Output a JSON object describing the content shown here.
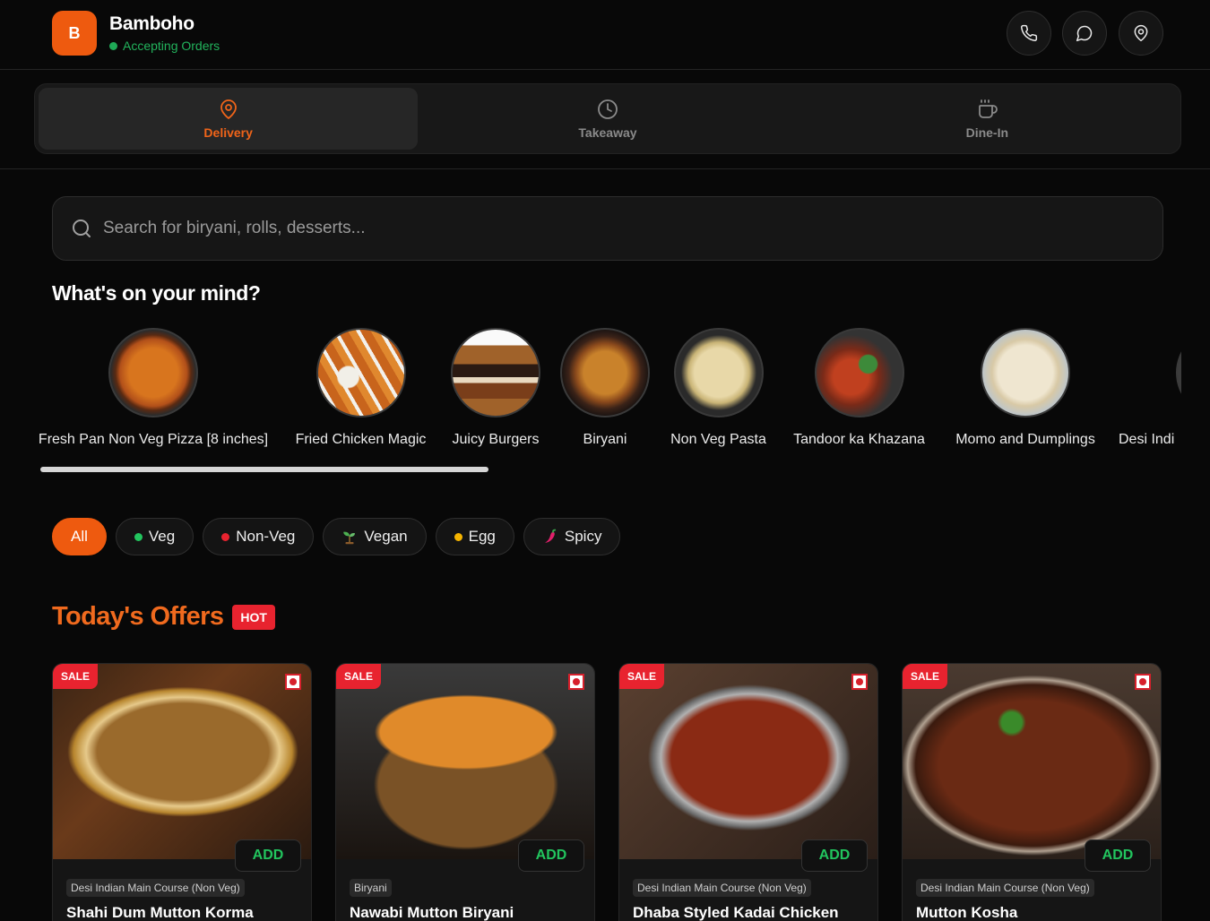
{
  "header": {
    "logo_letter": "B",
    "name": "Bamboho",
    "status": "Accepting Orders",
    "actions": [
      {
        "icon": "phone-icon"
      },
      {
        "icon": "chat-icon"
      },
      {
        "icon": "location-pin-icon"
      }
    ]
  },
  "tabs": [
    {
      "label": "Delivery",
      "icon": "location-pin-icon",
      "active": true
    },
    {
      "label": "Takeaway",
      "icon": "clock-icon",
      "active": false
    },
    {
      "label": "Dine-In",
      "icon": "coffee-cup-icon",
      "active": false
    }
  ],
  "search": {
    "placeholder": "Search for biryani, rolls, desserts...",
    "value": ""
  },
  "mind": {
    "title": "What's on your mind?",
    "categories": [
      {
        "label": "Fresh Pan Non Veg Pizza [8 inches]"
      },
      {
        "label": "Fried Chicken Magic"
      },
      {
        "label": "Juicy Burgers"
      },
      {
        "label": "Biryani"
      },
      {
        "label": "Non Veg Pasta"
      },
      {
        "label": "Tandoor ka Khazana"
      },
      {
        "label": "Momo and Dumplings"
      },
      {
        "label": "Desi Indi"
      }
    ]
  },
  "filters": [
    {
      "label": "All",
      "active": true
    },
    {
      "label": "Veg",
      "dot_color": "#22c55e"
    },
    {
      "label": "Non-Veg",
      "dot_color": "#e8232f"
    },
    {
      "label": "Vegan",
      "icon": "sprout-icon"
    },
    {
      "label": "Egg",
      "dot_color": "#f5b400"
    },
    {
      "label": "Spicy",
      "icon": "chili-icon"
    }
  ],
  "offers": {
    "title": "Today's Offers",
    "badge": "HOT",
    "items": [
      {
        "sale": "SALE",
        "add": "ADD",
        "category": "Desi Indian Main Course (Non Veg)",
        "name": "Shahi Dum Mutton Korma"
      },
      {
        "sale": "SALE",
        "add": "ADD",
        "category": "Biryani",
        "name": "Nawabi Mutton Biryani"
      },
      {
        "sale": "SALE",
        "add": "ADD",
        "category": "Desi Indian Main Course (Non Veg)",
        "name": "Dhaba Styled Kadai Chicken"
      },
      {
        "sale": "SALE",
        "add": "ADD",
        "category": "Desi Indian Main Course (Non Veg)",
        "name": "Mutton Kosha"
      }
    ]
  },
  "colors": {
    "accent": "#ee5a0f",
    "status_green": "#22b35c",
    "sale_red": "#e8232f",
    "add_green": "#22c55e"
  }
}
